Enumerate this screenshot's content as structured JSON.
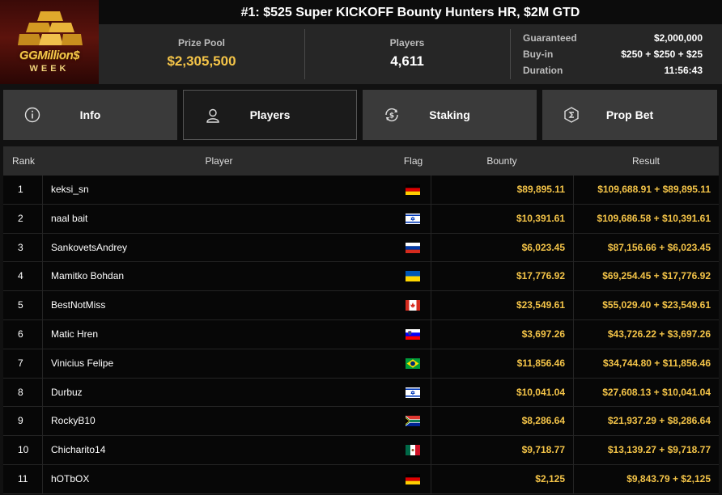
{
  "logo": {
    "brand": "GGMillion$",
    "subtitle": "WEEK"
  },
  "title": "#1: $525 Super KICKOFF Bounty Hunters HR, $2M GTD",
  "stats": {
    "prize_label": "Prize Pool",
    "prize_value": "$2,305,500",
    "players_label": "Players",
    "players_value": "4,611",
    "guaranteed_label": "Guaranteed",
    "guaranteed_value": "$2,000,000",
    "buyin_label": "Buy-in",
    "buyin_value": "$250 + $250 + $25",
    "duration_label": "Duration",
    "duration_value": "11:56:43"
  },
  "tabs": [
    {
      "label": "Info",
      "icon": "info-icon"
    },
    {
      "label": "Players",
      "icon": "user-icon"
    },
    {
      "label": "Staking",
      "icon": "dollar-cycle-icon"
    },
    {
      "label": "Prop Bet",
      "icon": "prop-bet-icon"
    }
  ],
  "active_tab": "Players",
  "table": {
    "headers": {
      "rank": "Rank",
      "player": "Player",
      "flag": "Flag",
      "bounty": "Bounty",
      "result": "Result"
    },
    "rows": [
      {
        "rank": "1",
        "player": "keksi_sn",
        "flag": "de",
        "bounty": "$89,895.11",
        "result": "$109,688.91 + $89,895.11"
      },
      {
        "rank": "2",
        "player": "naal bait",
        "flag": "il",
        "bounty": "$10,391.61",
        "result": "$109,686.58 + $10,391.61"
      },
      {
        "rank": "3",
        "player": "SankovetsAndrey",
        "flag": "ru",
        "bounty": "$6,023.45",
        "result": "$87,156.66 + $6,023.45"
      },
      {
        "rank": "4",
        "player": "Mamitko Bohdan",
        "flag": "ua",
        "bounty": "$17,776.92",
        "result": "$69,254.45 + $17,776.92"
      },
      {
        "rank": "5",
        "player": "BestNotMiss",
        "flag": "ca",
        "bounty": "$23,549.61",
        "result": "$55,029.40 + $23,549.61"
      },
      {
        "rank": "6",
        "player": "Matic Hren",
        "flag": "si",
        "bounty": "$3,697.26",
        "result": "$43,726.22 + $3,697.26"
      },
      {
        "rank": "7",
        "player": "Vinicius Felipe",
        "flag": "br",
        "bounty": "$11,856.46",
        "result": "$34,744.80 + $11,856.46"
      },
      {
        "rank": "8",
        "player": "Durbuz",
        "flag": "il",
        "bounty": "$10,041.04",
        "result": "$27,608.13 + $10,041.04"
      },
      {
        "rank": "9",
        "player": "RockyB10",
        "flag": "za",
        "bounty": "$8,286.64",
        "result": "$21,937.29 + $8,286.64"
      },
      {
        "rank": "10",
        "player": "Chicharito14",
        "flag": "mx",
        "bounty": "$9,718.77",
        "result": "$13,139.27 + $9,718.77"
      },
      {
        "rank": "11",
        "player": "hOTbOX",
        "flag": "de",
        "bounty": "$2,125",
        "result": "$9,843.79 + $2,125"
      }
    ]
  },
  "colors": {
    "gold": "#f4c448",
    "tab_bg": "#3a3a3a",
    "active_tab_bg": "#1b1b1b"
  }
}
